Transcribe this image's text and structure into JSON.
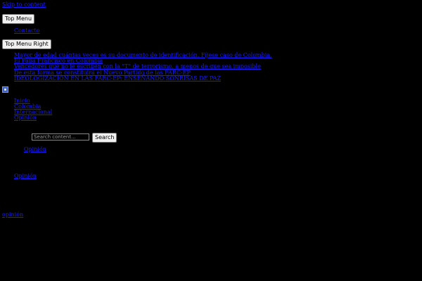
{
  "skip_link": "Skip to content",
  "top_menu": {
    "button_label": "Top Menu",
    "items": [
      {
        "label": "Contacto"
      }
    ]
  },
  "top_menu_right": {
    "button_label": "Top Menu Right",
    "items": [
      {
        "label": "Mayor de edad cuántas veces es su documento de identificación. Fíjese caso de Colombia."
      },
      {
        "label": "El Papa Francisco en Colombia"
      },
      {
        "label": "Vencedores que no le escriben con la \"T\" de terrorismo, a menos de que sea imposible"
      },
      {
        "label": "De esta forma se constituirá el Nuevo Partido de las FARC-EP"
      },
      {
        "label": "IDEOLOGIZACIÓN EN LAS FARC-EP: ENSEÑANDO SONRISAS DE PAZ"
      }
    ]
  },
  "main_menu": {
    "items": [
      {
        "label": "Inicio"
      },
      {
        "label": "Colombia"
      },
      {
        "label": "Internacional"
      },
      {
        "label": "Opinión"
      }
    ]
  },
  "search": {
    "placeholder": "Search content...",
    "button_label": "Search"
  },
  "links": {
    "opinion_1": "Opinión",
    "opinion_2": "Opinión",
    "footer": "opinión"
  }
}
